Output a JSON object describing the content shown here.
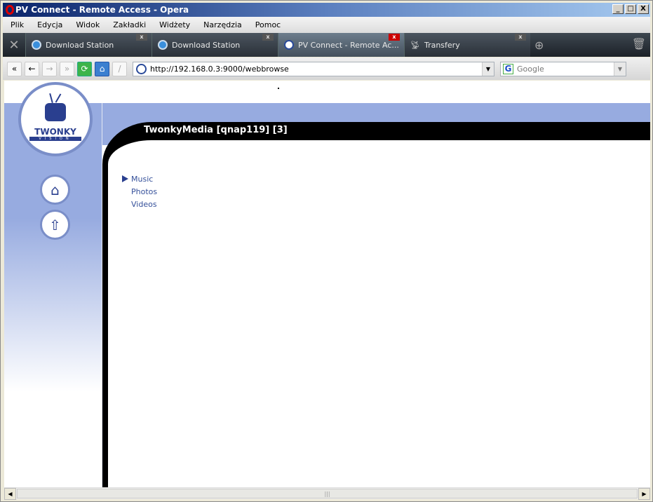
{
  "window": {
    "title": "PV Connect - Remote Access - Opera",
    "minimize": "_",
    "maximize": "□",
    "close": "X"
  },
  "menu": [
    "Plik",
    "Edycja",
    "Widok",
    "Zakładki",
    "Widżety",
    "Narzędzia",
    "Pomoc"
  ],
  "tabs": [
    {
      "label": "Download Station",
      "icon": "qnap-icon",
      "active": false
    },
    {
      "label": "Download Station",
      "icon": "qnap-icon",
      "active": false
    },
    {
      "label": "PV Connect - Remote Ac...",
      "icon": "twonky-icon",
      "active": true
    },
    {
      "label": "Transfery",
      "icon": "satellite-icon",
      "active": false
    }
  ],
  "tab_close": "x",
  "address": {
    "url": "http://192.168.0.3:9000/webbrowse"
  },
  "search": {
    "placeholder": "Google"
  },
  "page": {
    "header": "TwonkyMedia [qnap119] [3]",
    "logo_text": "TWONKY",
    "logo_sub": "VISION",
    "items": [
      {
        "label": "Music",
        "selected": true
      },
      {
        "label": "Photos",
        "selected": false
      },
      {
        "label": "Videos",
        "selected": false
      }
    ]
  },
  "colors": {
    "band": "#97abe0",
    "header": "#000000",
    "link": "#35509a",
    "logo": "#2a3f8f"
  }
}
